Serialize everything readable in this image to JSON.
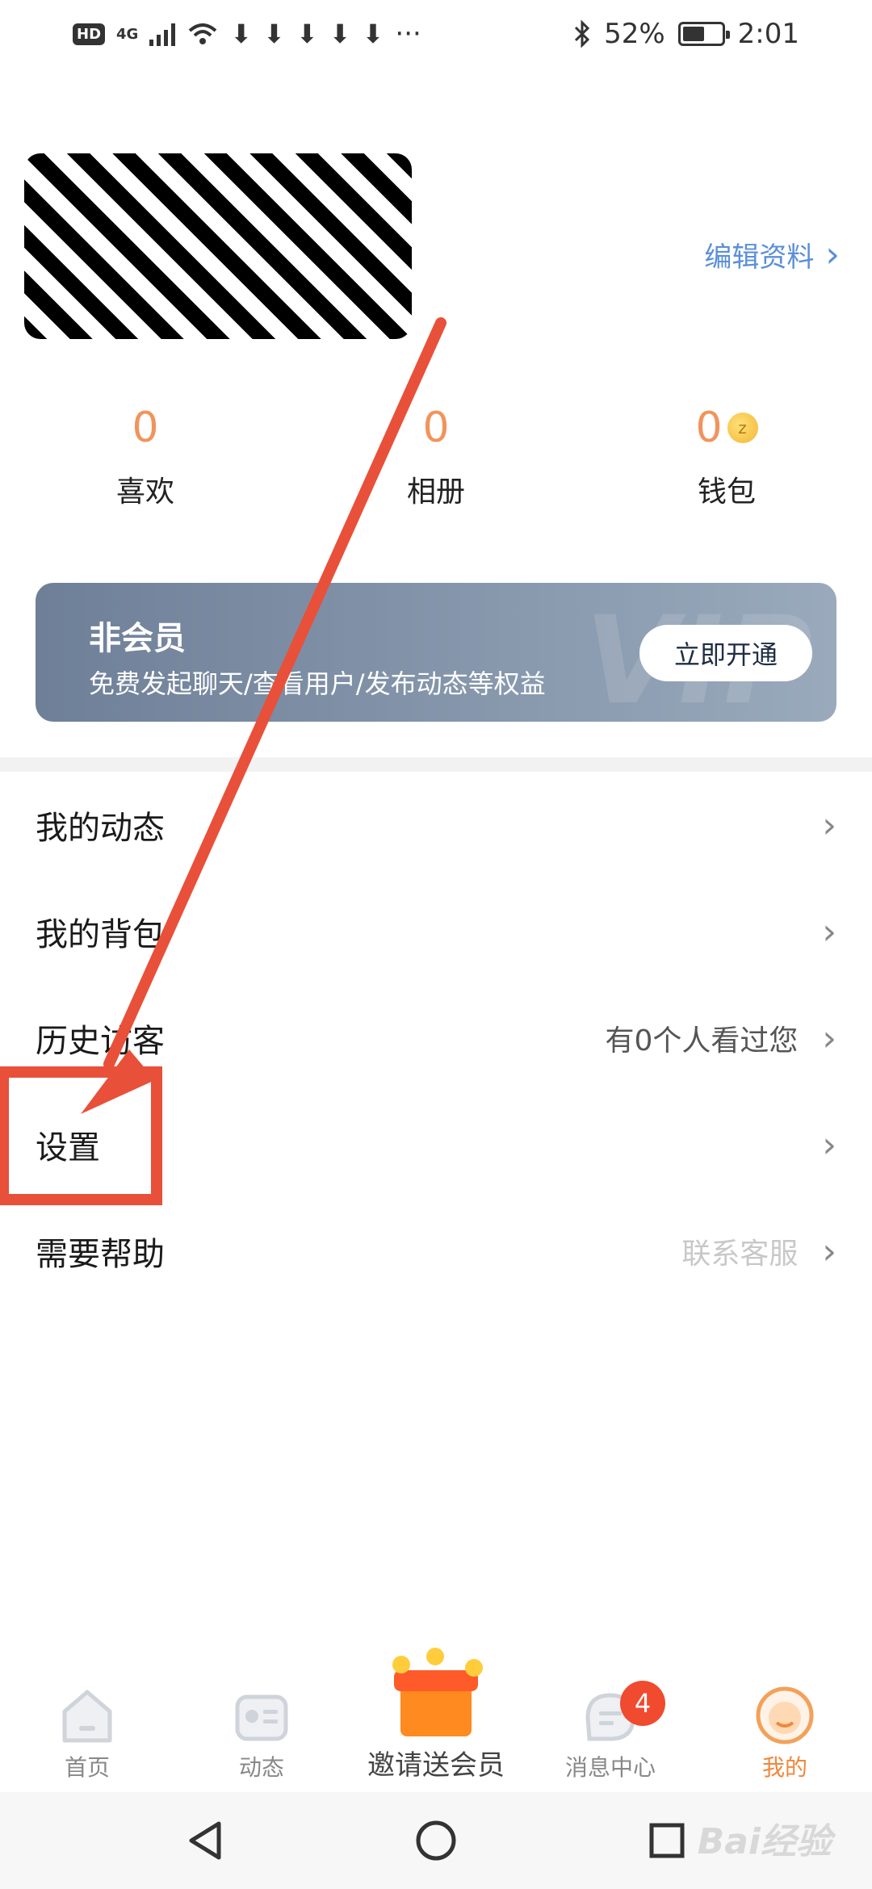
{
  "status_bar": {
    "network_badge": "HD",
    "network_type": "4G",
    "more_indicator": "···",
    "battery_percent": "52%",
    "time": "2:01"
  },
  "profile": {
    "edit_label": "编辑资料",
    "stats": [
      {
        "value": "0",
        "label": "喜欢"
      },
      {
        "value": "0",
        "label": "相册"
      },
      {
        "value": "0",
        "label": "钱包"
      }
    ]
  },
  "vip": {
    "title": "非会员",
    "subtitle": "免费发起聊天/查看用户/发布动态等权益",
    "button": "立即开通",
    "watermark": "VIP"
  },
  "menu": [
    {
      "label": "我的动态",
      "extra": ""
    },
    {
      "label": "我的背包",
      "extra": ""
    },
    {
      "label": "历史访客",
      "extra": "有0个人看过您"
    },
    {
      "label": "设置",
      "extra": ""
    },
    {
      "label": "需要帮助",
      "extra": "联系客服"
    }
  ],
  "tabs": [
    {
      "label": "首页",
      "icon": "home-icon"
    },
    {
      "label": "动态",
      "icon": "radio-icon"
    },
    {
      "label": "邀请送会员",
      "icon": "gift-icon"
    },
    {
      "label": "消息中心",
      "icon": "message-icon",
      "badge": "4"
    },
    {
      "label": "我的",
      "icon": "avatar-icon"
    }
  ],
  "colors": {
    "accent_orange": "#f1945c",
    "link_blue": "#5b8fd8",
    "annotation_red": "#e8503a",
    "badge_red": "#f04a2f"
  },
  "watermark": "Bai经验"
}
